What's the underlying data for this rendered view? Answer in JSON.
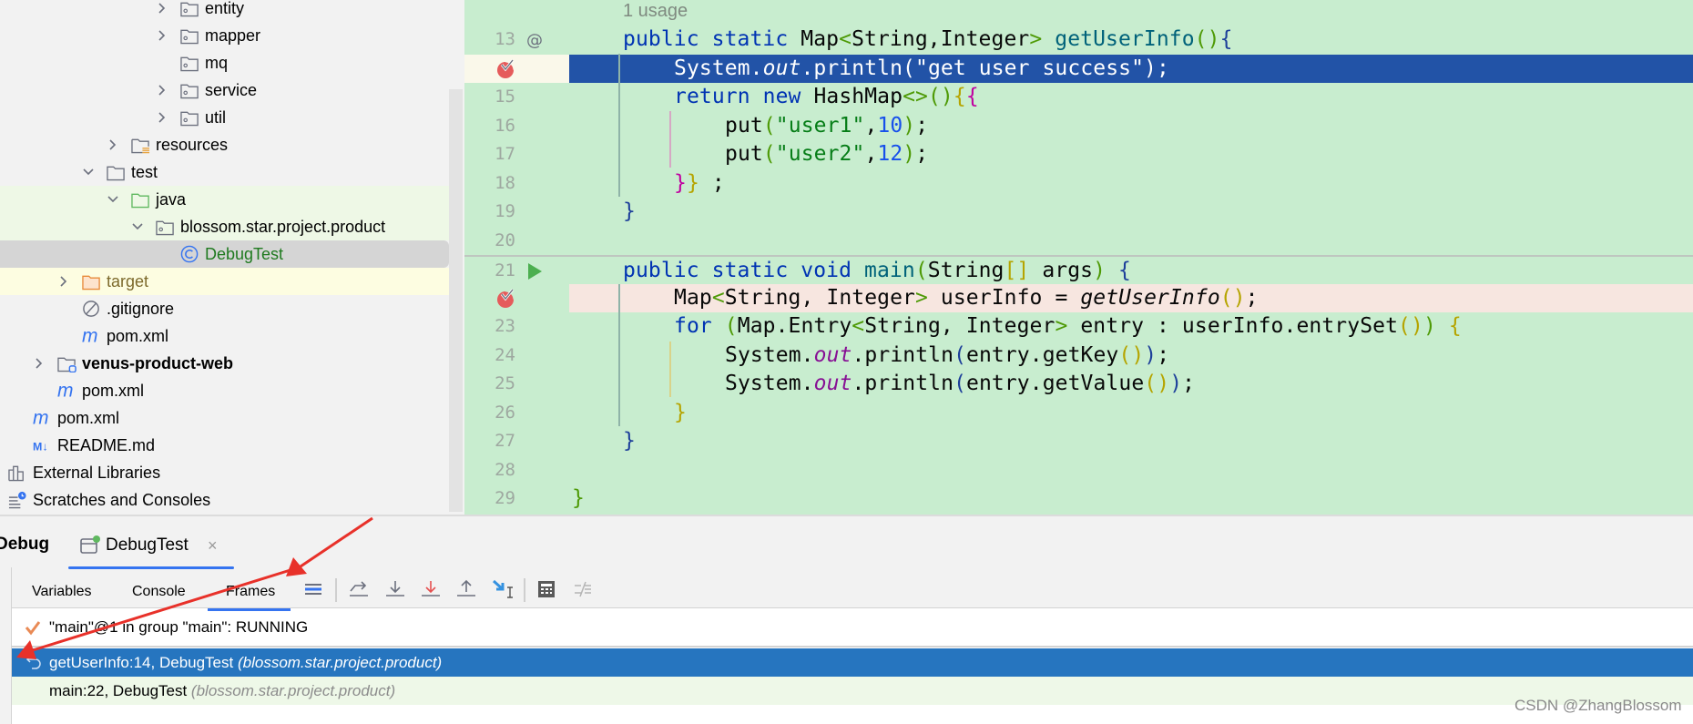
{
  "project_tree": {
    "items": [
      {
        "label": "entity",
        "level": 7,
        "chevron": "right",
        "icon": "package-folder"
      },
      {
        "label": "mapper",
        "level": 7,
        "chevron": "right",
        "icon": "package-folder"
      },
      {
        "label": "mq",
        "level": 7,
        "chevron": "none",
        "icon": "package-folder"
      },
      {
        "label": "service",
        "level": 7,
        "chevron": "right",
        "icon": "package-folder"
      },
      {
        "label": "util",
        "level": 7,
        "chevron": "right",
        "icon": "package-folder"
      },
      {
        "label": "resources",
        "level": 5,
        "chevron": "right",
        "icon": "resources-folder"
      },
      {
        "label": "test",
        "level": 4,
        "chevron": "down",
        "icon": "folder"
      },
      {
        "label": "java",
        "level": 5,
        "chevron": "down",
        "icon": "test-source-folder",
        "state": "green"
      },
      {
        "label": "blossom.star.project.product",
        "level": 6,
        "chevron": "down",
        "icon": "package-folder",
        "state": "green"
      },
      {
        "label": "DebugTest",
        "level": 7,
        "chevron": "none",
        "icon": "class-icon",
        "state": "sel",
        "color": "#1f7a1f"
      },
      {
        "label": "target",
        "level": 3,
        "chevron": "right",
        "icon": "excluded-folder",
        "state": "yellow",
        "color": "#7d6a2c"
      },
      {
        "label": ".gitignore",
        "level": 3,
        "chevron": "none",
        "icon": "gitignore-file"
      },
      {
        "label": "pom.xml",
        "level": 3,
        "chevron": "none",
        "icon": "maven-file"
      },
      {
        "label": "venus-product-web",
        "level": 2,
        "chevron": "right",
        "icon": "module-folder",
        "state": "bold"
      },
      {
        "label": "pom.xml",
        "level": 2,
        "chevron": "none",
        "icon": "maven-file"
      },
      {
        "label": "pom.xml",
        "level": 1,
        "chevron": "none",
        "icon": "maven-file"
      },
      {
        "label": "README.md",
        "level": 1,
        "chevron": "none",
        "icon": "markdown-file"
      },
      {
        "label": "External Libraries",
        "level": 0,
        "chevron": "none",
        "icon": "libraries"
      },
      {
        "label": "Scratches and Consoles",
        "level": 0,
        "chevron": "none",
        "icon": "scratches"
      }
    ]
  },
  "editor": {
    "usage_hint": "1 usage",
    "current_line": 14,
    "lines": [
      {
        "no": "13",
        "marker": "at-icon",
        "indent": 0,
        "tokens": [
          [
            "public ",
            "k"
          ],
          [
            "static ",
            "k"
          ],
          [
            "Map",
            ""
          ],
          [
            "<",
            "g"
          ],
          [
            "String,Integer",
            ""
          ],
          [
            ">",
            "g"
          ],
          [
            " ",
            ""
          ],
          [
            "getUserInfo",
            "d"
          ],
          [
            "(",
            "g"
          ],
          [
            ")",
            "g"
          ],
          [
            "{",
            "b"
          ]
        ]
      },
      {
        "no": "14",
        "marker": "breakpoint-check-icon",
        "indent": 4,
        "state": "cur",
        "tokens": [
          [
            "System.",
            ""
          ],
          [
            "out",
            "f"
          ],
          [
            ".println(\"get user success\");",
            ""
          ]
        ]
      },
      {
        "no": "15",
        "indent": 4,
        "tokens": [
          [
            "return ",
            "k"
          ],
          [
            "new ",
            "k"
          ],
          [
            "HashMap",
            ""
          ],
          [
            "<>",
            "g"
          ],
          [
            "()",
            "g"
          ],
          [
            "{",
            "y"
          ],
          [
            "{",
            "m"
          ]
        ]
      },
      {
        "no": "16",
        "indent": 8,
        "tokens": [
          [
            "put",
            ""
          ],
          [
            "(",
            "g"
          ],
          [
            "\"user1\"",
            "s"
          ],
          [
            ",",
            ""
          ],
          [
            "10",
            "n"
          ],
          [
            ")",
            "g"
          ],
          [
            ";",
            ""
          ]
        ]
      },
      {
        "no": "17",
        "indent": 8,
        "tokens": [
          [
            "put",
            ""
          ],
          [
            "(",
            "g"
          ],
          [
            "\"user2\"",
            "s"
          ],
          [
            ",",
            ""
          ],
          [
            "12",
            "n"
          ],
          [
            ")",
            "g"
          ],
          [
            ";",
            ""
          ]
        ]
      },
      {
        "no": "18",
        "indent": 4,
        "tokens": [
          [
            "}",
            "m"
          ],
          [
            "}",
            "y"
          ],
          [
            " ;",
            ""
          ]
        ]
      },
      {
        "no": "19",
        "indent": 0,
        "tokens": [
          [
            "}",
            "b"
          ]
        ]
      },
      {
        "no": "20",
        "indent": 0,
        "tokens": []
      },
      {
        "no": "21",
        "marker": "run-icon",
        "indent": 0,
        "state": "sep",
        "tokens": [
          [
            "public ",
            "k"
          ],
          [
            "static ",
            "k"
          ],
          [
            "void ",
            "k"
          ],
          [
            "main",
            "d"
          ],
          [
            "(",
            "g"
          ],
          [
            "String",
            ""
          ],
          [
            "[]",
            "y"
          ],
          [
            " args",
            ""
          ],
          [
            ")",
            "g"
          ],
          [
            " ",
            ""
          ],
          [
            "{",
            "b"
          ]
        ]
      },
      {
        "no": "22",
        "marker": "breakpoint-check-icon",
        "indent": 4,
        "state": "bp",
        "tokens": [
          [
            "Map",
            ""
          ],
          [
            "<",
            "g"
          ],
          [
            "String, Integer",
            ""
          ],
          [
            ">",
            "g"
          ],
          [
            " userInfo = ",
            ""
          ],
          [
            "getUserInfo",
            "i"
          ],
          [
            "()",
            "y"
          ],
          [
            ";",
            ""
          ]
        ]
      },
      {
        "no": "23",
        "indent": 4,
        "tokens": [
          [
            "for ",
            "k"
          ],
          [
            "(",
            "g"
          ],
          [
            "Map.Entry",
            ""
          ],
          [
            "<",
            "g"
          ],
          [
            "String, Integer",
            ""
          ],
          [
            ">",
            "g"
          ],
          [
            " entry : userInfo.entrySet",
            ""
          ],
          [
            "()",
            "y"
          ],
          [
            ")",
            "g"
          ],
          [
            " ",
            ""
          ],
          [
            "{",
            "y"
          ]
        ]
      },
      {
        "no": "24",
        "indent": 8,
        "tokens": [
          [
            "System.",
            ""
          ],
          [
            "out",
            "f"
          ],
          [
            ".println",
            ""
          ],
          [
            "(",
            "b"
          ],
          [
            "entry.getKey",
            ""
          ],
          [
            "()",
            "y"
          ],
          [
            ")",
            "b"
          ],
          [
            ";",
            ""
          ]
        ]
      },
      {
        "no": "25",
        "indent": 8,
        "tokens": [
          [
            "System.",
            ""
          ],
          [
            "out",
            "f"
          ],
          [
            ".println",
            ""
          ],
          [
            "(",
            "b"
          ],
          [
            "entry.getValue",
            ""
          ],
          [
            "()",
            "y"
          ],
          [
            ")",
            "b"
          ],
          [
            ";",
            ""
          ]
        ]
      },
      {
        "no": "26",
        "indent": 4,
        "tokens": [
          [
            "}",
            "y"
          ]
        ]
      },
      {
        "no": "27",
        "indent": 0,
        "tokens": [
          [
            "}",
            "b"
          ]
        ]
      },
      {
        "no": "28",
        "indent": 0,
        "tokens": []
      },
      {
        "no": "29",
        "indent": -4,
        "tokens": [
          [
            "}",
            "g"
          ]
        ]
      }
    ]
  },
  "debug_panel": {
    "title": "Debug",
    "run_tab": "DebugTest",
    "tabs": [
      "Variables",
      "Console",
      "Frames"
    ],
    "active_tab": "Frames",
    "toolbar": [
      "frames-list-icon",
      "step-over-icon",
      "step-into-icon",
      "force-step-into-icon",
      "step-out-icon",
      "run-to-cursor-icon",
      "evaluate-expression-icon",
      "mute-breakpoints-icon"
    ],
    "thread": "\"main\"@1 in group \"main\": RUNNING",
    "frames": [
      {
        "method": "getUserInfo:14, DebugTest ",
        "package": "(blossom.star.project.product)",
        "selected": true
      },
      {
        "method": "main:22, DebugTest ",
        "package": "(blossom.star.project.product)",
        "selected": false
      }
    ]
  },
  "watermark": "CSDN @ZhangBlossom",
  "colors": {
    "editor_bg": "#c8edcf",
    "current_line": "#2253a7",
    "breakpoint_line": "#f7e6e0",
    "selected_frame": "#2675bf",
    "accent": "#3574f0",
    "annotation_arrow": "#e8312a"
  }
}
